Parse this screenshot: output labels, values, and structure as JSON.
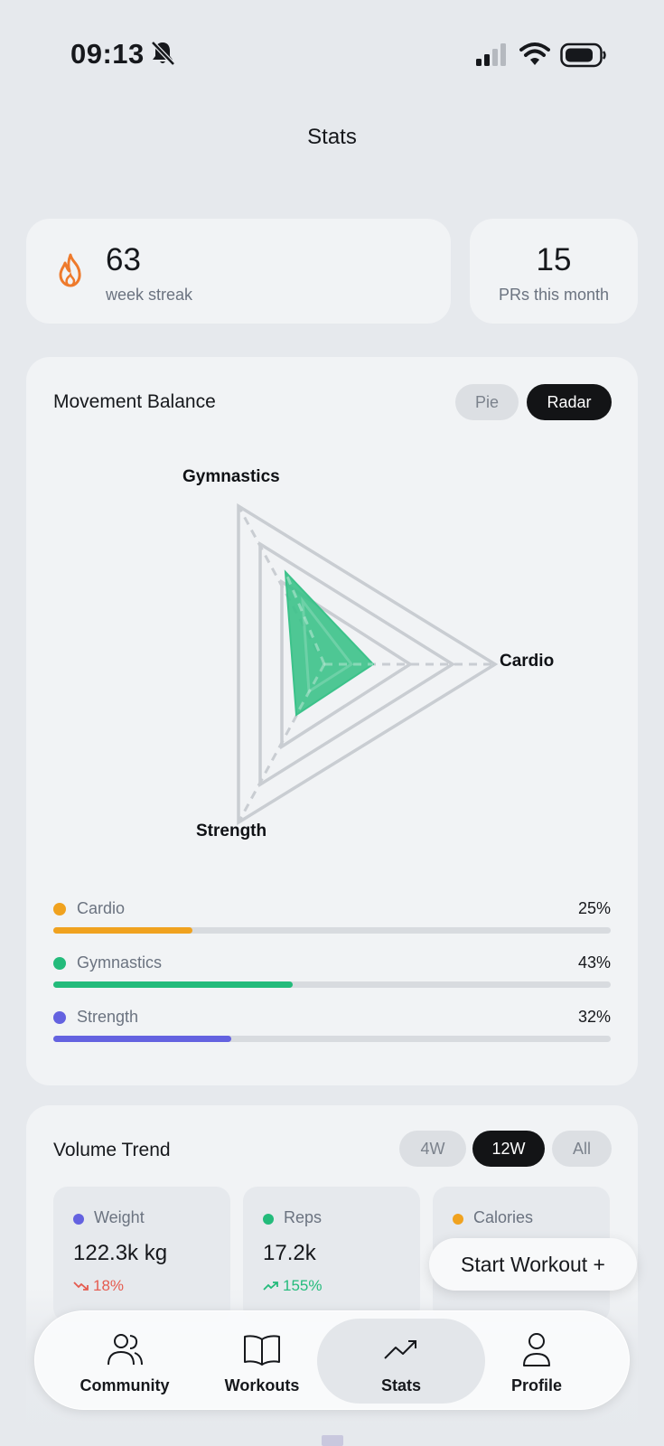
{
  "status_bar": {
    "time": "09:13",
    "icons": [
      "bell-slash-icon",
      "signal-icon",
      "wifi-icon",
      "battery-icon"
    ]
  },
  "page": {
    "title": "Stats"
  },
  "streak": {
    "value": "63",
    "label": "week streak",
    "icon": "flame-icon",
    "color": "#ee7a2c"
  },
  "prs": {
    "value": "15",
    "label": "PRs this month"
  },
  "movement_balance": {
    "title": "Movement Balance",
    "toggle": {
      "options": [
        "Pie",
        "Radar"
      ],
      "selected": "Radar"
    },
    "radar": {
      "axes": [
        "Gymnastics",
        "Cardio",
        "Strength"
      ],
      "fill_color": "#3cc28a"
    },
    "breakdown": [
      {
        "name": "Cardio",
        "percent_label": "25%",
        "fraction": 0.25,
        "color": "#f0a21f"
      },
      {
        "name": "Gymnastics",
        "percent_label": "43%",
        "fraction": 0.43,
        "color": "#23bb7b"
      },
      {
        "name": "Strength",
        "percent_label": "32%",
        "fraction": 0.32,
        "color": "#6462e0"
      }
    ]
  },
  "volume_trend": {
    "title": "Volume Trend",
    "toggle": {
      "options": [
        "4W",
        "12W",
        "All"
      ],
      "selected": "12W"
    },
    "stats": [
      {
        "name": "Weight",
        "value": "122.3k kg",
        "delta": "18%",
        "direction": "down",
        "color": "#6462e0",
        "delta_color": "#e55a4e"
      },
      {
        "name": "Reps",
        "value": "17.2k",
        "delta": "155%",
        "direction": "up",
        "color": "#23bb7b",
        "delta_color": "#23bb7b"
      },
      {
        "name": "Calories",
        "value": "",
        "delta": "",
        "direction": "up",
        "color": "#f0a21f",
        "delta_color": "#23bb7b"
      }
    ]
  },
  "start_workout": {
    "label": "Start Workout +"
  },
  "nav": {
    "items": [
      {
        "label": "Community",
        "icon": "users-icon"
      },
      {
        "label": "Workouts",
        "icon": "book-icon"
      },
      {
        "label": "Stats",
        "icon": "trend-icon",
        "active": true
      },
      {
        "label": "Profile",
        "icon": "person-icon"
      }
    ]
  }
}
